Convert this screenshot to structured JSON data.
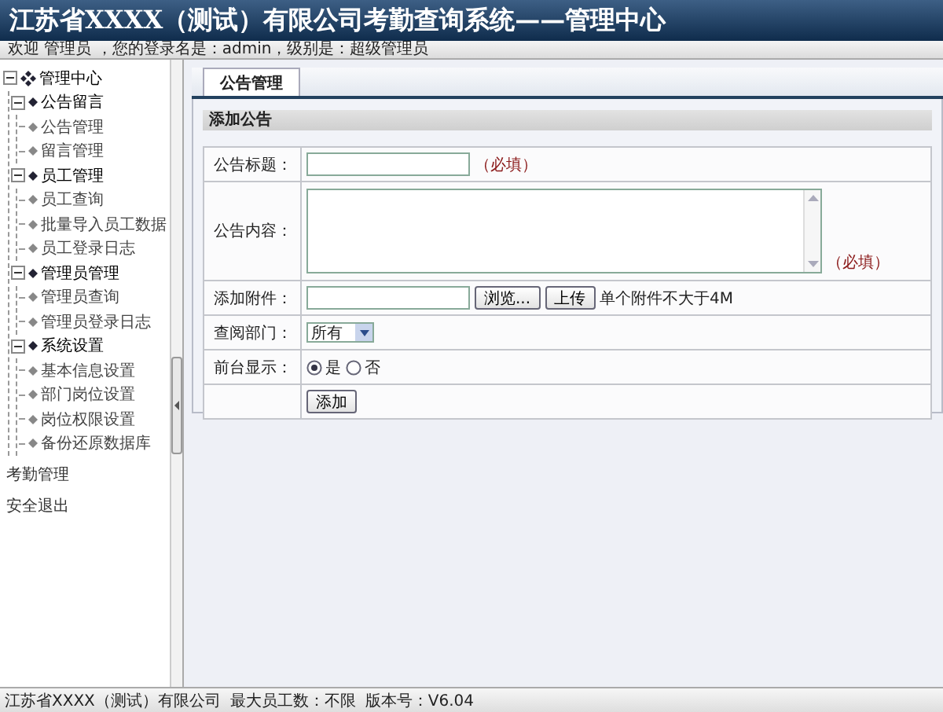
{
  "header": {
    "title": "江苏省XXXX（测试）有限公司考勤查询系统——管理中心",
    "welcome": "欢迎 管理员 ，您的登录名是：admin，级别是：超级管理员"
  },
  "sidebar": {
    "tree": {
      "label": "管理中心",
      "expanded": true,
      "children": [
        {
          "label": "公告留言",
          "expanded": true,
          "children": [
            {
              "label": "公告管理"
            },
            {
              "label": "留言管理"
            }
          ]
        },
        {
          "label": "员工管理",
          "expanded": true,
          "children": [
            {
              "label": "员工查询"
            },
            {
              "label": "批量导入员工数据"
            },
            {
              "label": "员工登录日志"
            }
          ]
        },
        {
          "label": "管理员管理",
          "expanded": true,
          "children": [
            {
              "label": "管理员查询"
            },
            {
              "label": "管理员登录日志"
            }
          ]
        },
        {
          "label": "系统设置",
          "expanded": true,
          "children": [
            {
              "label": "基本信息设置"
            },
            {
              "label": "部门岗位设置"
            },
            {
              "label": "岗位权限设置"
            },
            {
              "label": "备份还原数据库"
            }
          ]
        }
      ]
    },
    "links": [
      "考勤管理",
      "安全退出"
    ]
  },
  "tabs": [
    {
      "label": "公告管理",
      "selected": true
    }
  ],
  "section_title": "添加公告",
  "form": [
    {
      "kind": "text",
      "label": "公告标题：",
      "note": "（必填）"
    },
    {
      "kind": "textarea",
      "label": "公告内容：",
      "note": "（必填）"
    },
    {
      "kind": "file",
      "label": "添加附件：",
      "browse": "浏览...",
      "upload": "上传",
      "note": "单个附件不大于4M"
    },
    {
      "kind": "select",
      "label": "查阅部门：",
      "value": "所有"
    },
    {
      "kind": "radio",
      "label": "前台显示：",
      "options": [
        {
          "label": "是",
          "selected": true
        },
        {
          "label": "否",
          "selected": false
        }
      ]
    },
    {
      "kind": "submit",
      "button": "添加"
    }
  ],
  "footer": [
    "江苏省XXXX（测试）有限公司",
    "最大员工数：不限",
    "版本号：V6.04"
  ]
}
